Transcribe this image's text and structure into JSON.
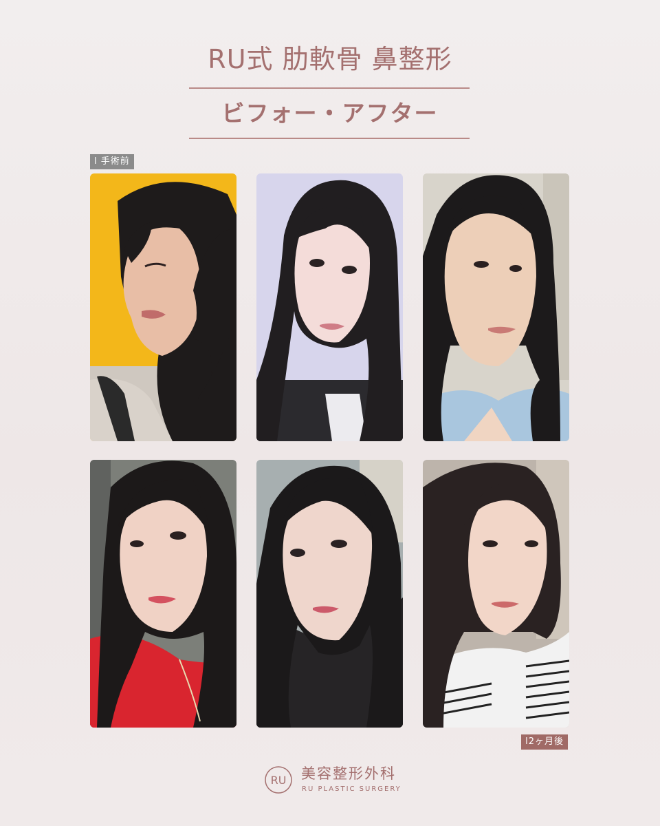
{
  "header": {
    "title": "RU式 肋軟骨 鼻整形",
    "subtitle": "ビフォー・アフター"
  },
  "labels": {
    "before": "l 手術前",
    "after": "l2ヶ月後"
  },
  "brand": {
    "monogram": "RU",
    "name_jp": "美容整形外科",
    "name_en": "RU PLASTIC SURGERY",
    "accent": "#a4706f"
  },
  "photos": {
    "before_row": [
      "photo-before-left-profile",
      "photo-before-front",
      "photo-before-right-profile"
    ],
    "after_row": [
      "photo-after-left-profile",
      "photo-after-front",
      "photo-after-right-profile"
    ]
  }
}
